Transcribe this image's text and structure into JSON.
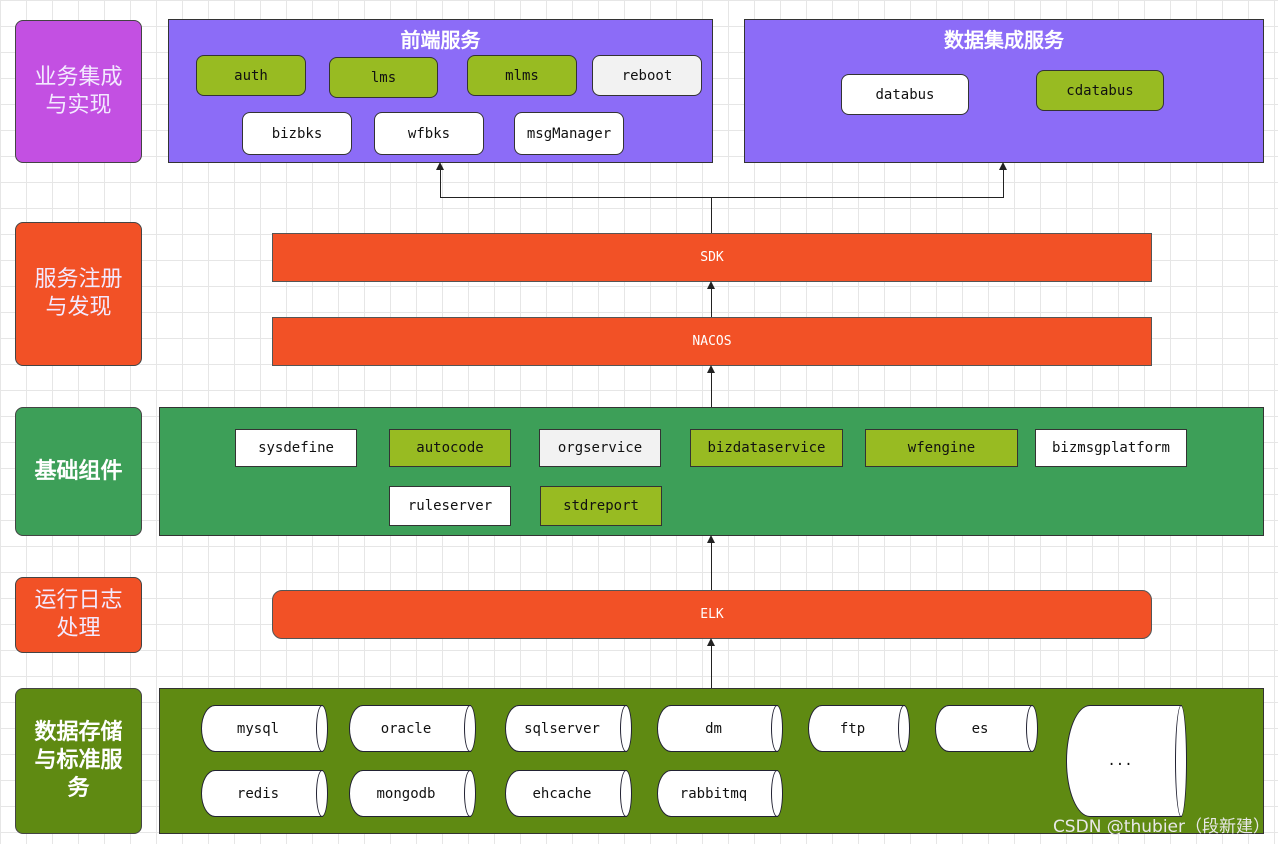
{
  "layers": {
    "integration": "业务集成与实现",
    "registry": "服务注册与发现",
    "components": "基础组件",
    "logging": "运行日志处理",
    "storage": "数据存储与标准服务"
  },
  "frontend": {
    "title": "前端服务",
    "items": [
      "auth",
      "lms",
      "mlms",
      "reboot",
      "bizbks",
      "wfbks",
      "msgManager"
    ]
  },
  "data_integration": {
    "title": "数据集成服务",
    "items": [
      "databus",
      "cdatabus"
    ]
  },
  "sdk": "SDK",
  "nacos": "NACOS",
  "components": {
    "items": [
      "sysdefine",
      "autocode",
      "orgservice",
      "bizdataservice",
      "wfengine",
      "bizmsgplatform",
      "ruleserver",
      "stdreport"
    ]
  },
  "elk": "ELK",
  "storage": {
    "items": [
      "mysql",
      "oracle",
      "sqlserver",
      "dm",
      "ftp",
      "es",
      "redis",
      "mongodb",
      "ehcache",
      "rabbitmq",
      "..."
    ]
  },
  "watermark": "CSDN @thubier（段新建）",
  "colors": {
    "purple_panel": "#8c6cf7",
    "magenta": "#c350e2",
    "orange": "#f25126",
    "green": "#3d9f58",
    "dark_green": "#5f8a12",
    "lime": "#98bb22"
  }
}
